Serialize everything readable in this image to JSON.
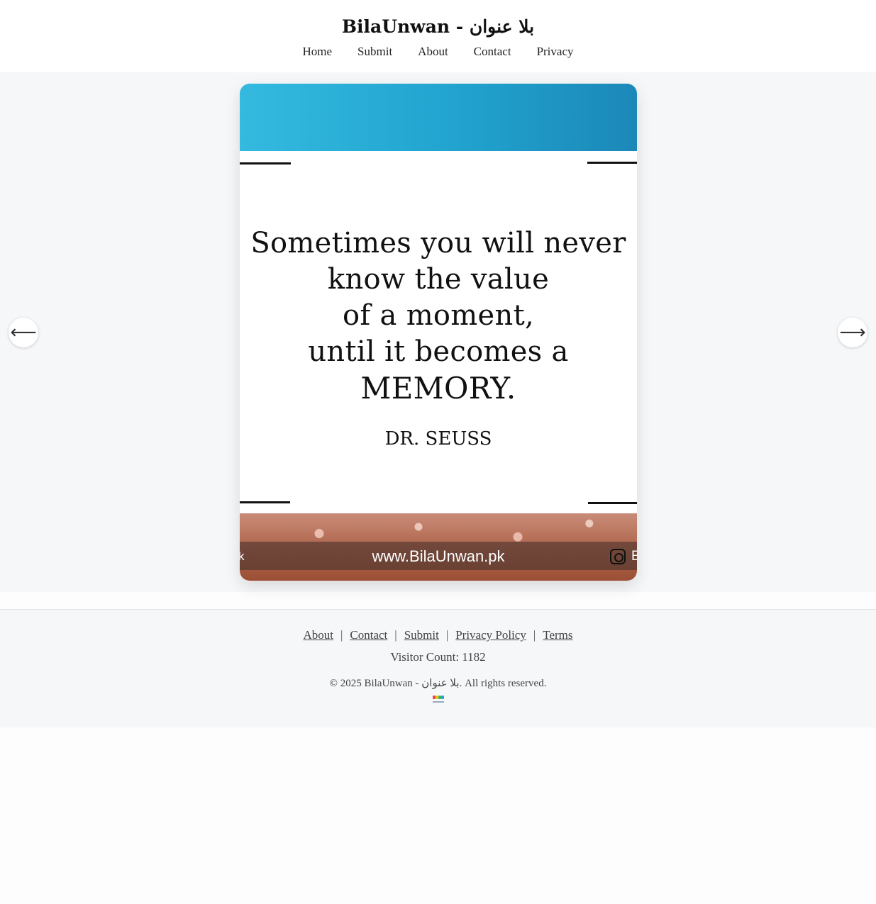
{
  "site": {
    "title": "BilaUnwan - بلا عنوان"
  },
  "nav": {
    "items": [
      {
        "label": "Home"
      },
      {
        "label": "Submit"
      },
      {
        "label": "About"
      },
      {
        "label": "Contact"
      },
      {
        "label": "Privacy"
      }
    ]
  },
  "viewer": {
    "prev_icon": "arrow-left-icon",
    "next_icon": "arrow-right-icon",
    "prev_glyph": "⟵",
    "next_glyph": "⟶"
  },
  "card": {
    "quote_lines": [
      "Sometimes you will never",
      "know the value",
      "of  a moment,",
      "until it becomes a",
      "MEMORY."
    ],
    "author": "DR. SEUSS",
    "band_url": "www.BilaUnwan.pk",
    "band_left": "k",
    "band_right": "E",
    "top_band_color": "#22a6d1"
  },
  "footer": {
    "links": [
      {
        "label": "About"
      },
      {
        "label": "Contact"
      },
      {
        "label": "Submit"
      },
      {
        "label": "Privacy Policy"
      },
      {
        "label": "Terms"
      }
    ],
    "separator": "|",
    "visitor_count": "Visitor Count: 1182",
    "copyright": "© 2025 BilaUnwan - بلا عنوان. All rights reserved."
  }
}
